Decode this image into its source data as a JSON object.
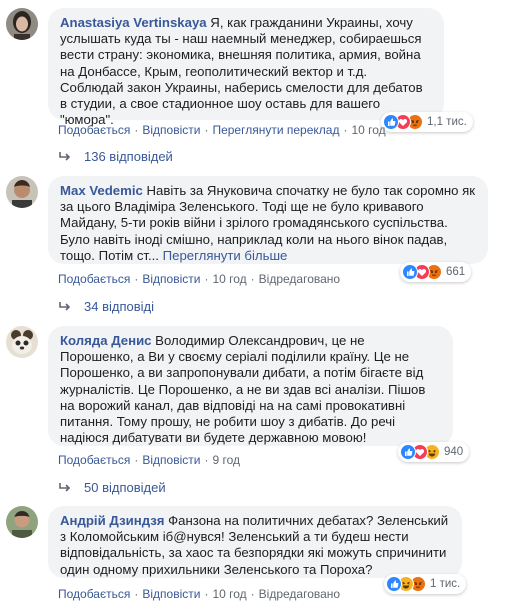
{
  "colors": {
    "link": "#385898",
    "meta": "#606770",
    "bubble": "#f2f3f5",
    "like": "#2d88ff",
    "love": "#f33e58",
    "haha": "#f7b125",
    "angry": "#e9710f"
  },
  "comments": [
    {
      "author": "Anastasiya Vertinskaya",
      "text": " Я, как гражданини Украины, хочу услышать куда ты - наш наемный менеджер, собираешься вести страну: экономика, внешняя политика, армия, война на Донбассе, Крым, геополитический вектор и т.д. Соблюдай закон Украины, наберись смелости для дебатов в студии, а свое стадионное шоу оставь для вашего \"юмора\".",
      "actions": {
        "like": "Подобається",
        "reply": "Відповісти",
        "extra": "Переглянути переклад",
        "time": "10 год"
      },
      "reactions": {
        "icons": [
          "like-icon",
          "love-icon",
          "angry-icon"
        ],
        "count": "1,1 тис."
      },
      "replies": "136 відповідей"
    },
    {
      "author": "Max Vedemic",
      "text": " Навіть за Януковича спочатку не було так соромно як за цього Владіміра Зеленського. Тоді ще не було кривавого Майдану, 5-ти років війни і зрілого громадянського суспільства. Було навіть іноді смішно, наприклад коли на нього вінок падав, тощо. Потім ст... ",
      "see_more": "Переглянути більше",
      "actions": {
        "like": "Подобається",
        "reply": "Відповісти",
        "time": "10 год",
        "extra": "Відредаговано"
      },
      "reactions": {
        "icons": [
          "like-icon",
          "love-icon",
          "angry-icon"
        ],
        "count": "661"
      },
      "replies": "34 відповіді"
    },
    {
      "author": "Коляда Денис",
      "text": " Володимир Олександрович, це не Порошенко, а Ви у своєму серіалі поділили країну. Це не Порошенко, а ви запропонували дибати, а потім бігаєте від журналістів. Це Порошенко, а не ви здав всі аналізи. Пішов на ворожий канал, дав відповіді на на самі провокативні питання. Тому прошу, не робити шоу з дибатів. До речі надіюся дибатувати ви будете державною мовою!",
      "actions": {
        "like": "Подобається",
        "reply": "Відповісти",
        "time": "9 год"
      },
      "reactions": {
        "icons": [
          "like-icon",
          "love-icon",
          "haha-icon"
        ],
        "count": "940"
      },
      "replies": "50 відповідей"
    },
    {
      "author": "Андрій Дзиндзя",
      "text": " Фанзона на политичних дебатах? Зеленський з Коломойським іб@нувся! Зеленський а ти будеш нести відповідальність, за хаос та безпорядки які можуть спричинити один одному прихильники Зеленського та Пороха?",
      "actions": {
        "like": "Подобається",
        "reply": "Відповісти",
        "time": "10 год",
        "extra": "Відредаговано"
      },
      "reactions": {
        "icons": [
          "like-icon",
          "haha-icon",
          "angry-icon"
        ],
        "count": "1 тис."
      }
    }
  ]
}
